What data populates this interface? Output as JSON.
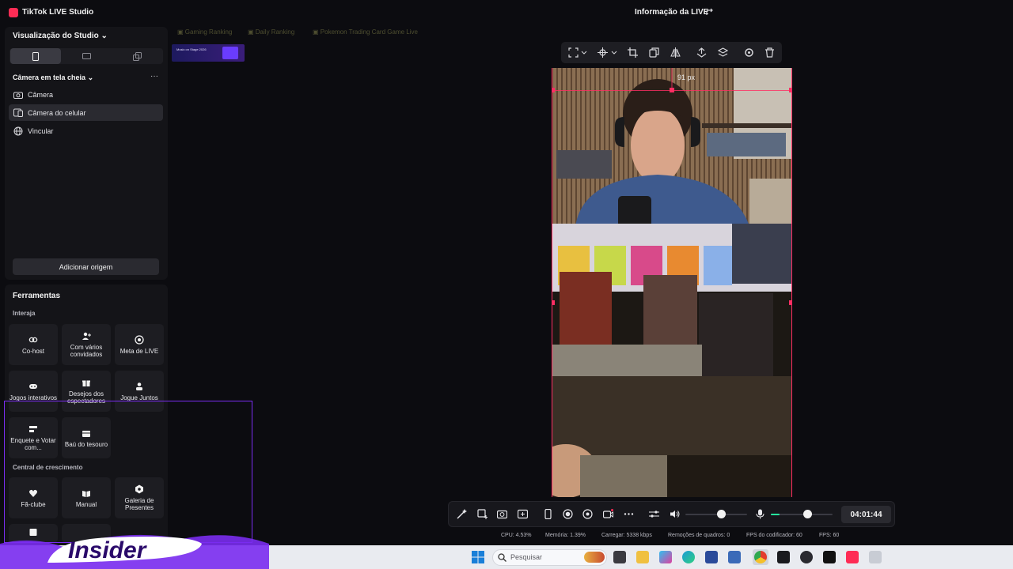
{
  "app": {
    "title": "TikTok LIVE Studio",
    "live_info": "Informação da LIVE"
  },
  "left": {
    "studio_view": "Visualização do Studio",
    "scene_title": "Câmera em tela cheia",
    "more": "···",
    "sources": [
      {
        "label": "Câmera",
        "icon": "camera-icon"
      },
      {
        "label": "Câmera do celular",
        "icon": "phone-camera-icon"
      },
      {
        "label": "Vincular",
        "icon": "globe-icon"
      }
    ],
    "add_source": "Adicionar origem"
  },
  "tools": {
    "title": "Ferramentas",
    "interact_label": "Interaja",
    "growth_label": "Central de crescimento",
    "interact": [
      {
        "label": "Co-host",
        "icon": "link-icon"
      },
      {
        "label": "Com vários convidados",
        "icon": "users-icon"
      },
      {
        "label": "Meta de LIVE",
        "icon": "target-icon"
      },
      {
        "label": "Jogos interativos",
        "icon": "gamepad-icon"
      },
      {
        "label": "Desejos dos espectadores",
        "icon": "gift-icon"
      },
      {
        "label": "Jogue Juntos",
        "icon": "player-icon"
      },
      {
        "label": "Enquete e Votar com...",
        "icon": "poll-icon"
      },
      {
        "label": "Baú do tesouro",
        "icon": "chest-icon"
      }
    ],
    "growth": [
      {
        "label": "Fã-clube",
        "icon": "heart-icon"
      },
      {
        "label": "Manual",
        "icon": "book-icon"
      },
      {
        "label": "Galeria de Presentes",
        "icon": "gallery-icon"
      }
    ]
  },
  "overlay_tabs": [
    "Gaming Ranking",
    "Daily Ranking",
    "Pokemon Trading Card Game Live"
  ],
  "banner_text": "Music on Stage 2026",
  "preview": {
    "px_label": "91 px"
  },
  "controls": {
    "timer": "04:01:44",
    "volume_level": 0.2,
    "mic_level": 0.4
  },
  "stats": {
    "cpu": "CPU: 4.53%",
    "memory": "Memória: 1.39%",
    "upload": "Carregar: 5338 kbps",
    "dropped": "Remoções de quadros: 0",
    "encoder_fps": "FPS do codificador: 60",
    "fps": "FPS: 60"
  },
  "taskbar": {
    "search_placeholder": "Pesquisar"
  },
  "watermark": "Insider",
  "colors": {
    "accent": "#fe2c55",
    "panel": "#141418",
    "selection": "#ff2e63",
    "watermark": "#7a2cf0"
  }
}
